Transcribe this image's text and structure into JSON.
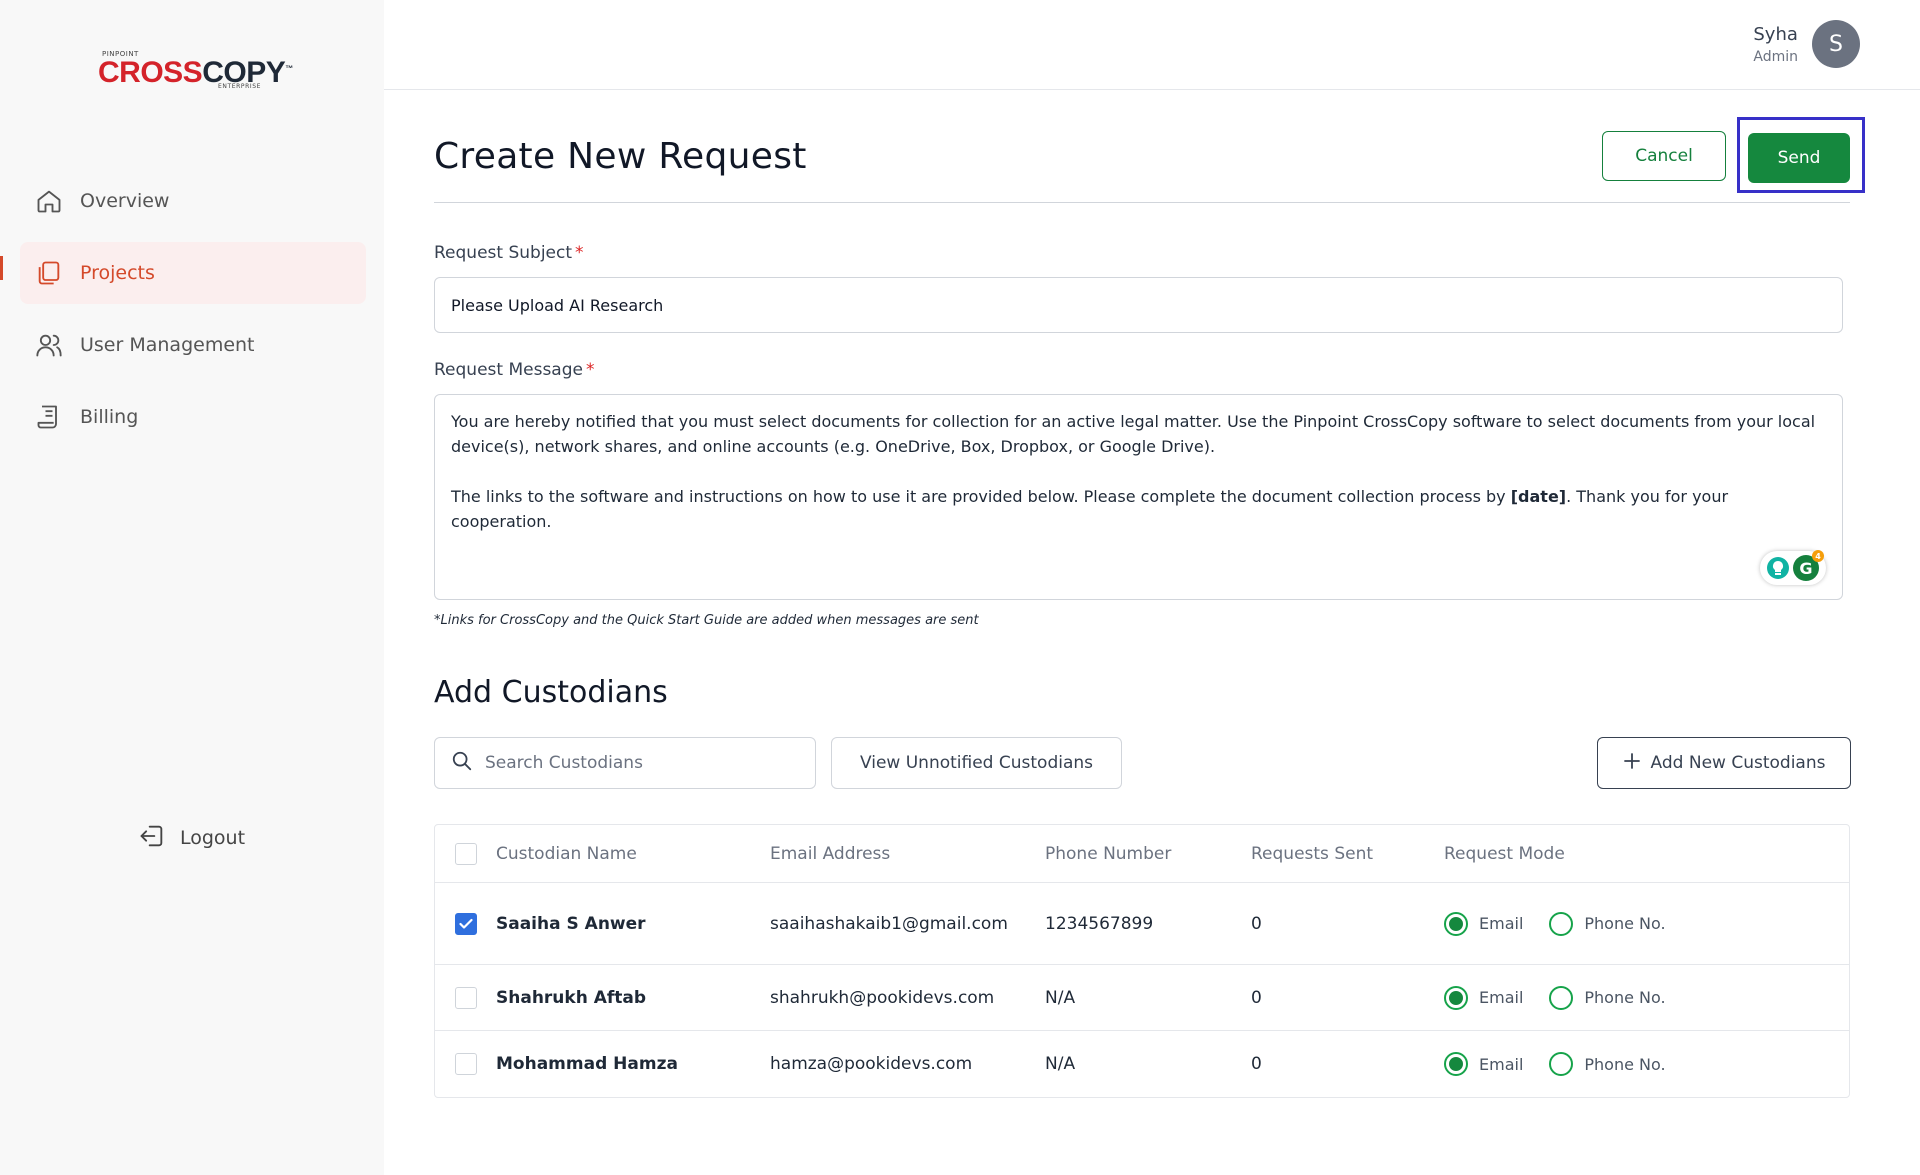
{
  "brand": {
    "pinpoint": "PINPOINT",
    "name_red": "CROSS",
    "name_dark": "COPY",
    "tm": "™",
    "enterprise": "ENTERPRISE"
  },
  "sidebar": {
    "items": [
      {
        "label": "Overview",
        "icon": "home-icon",
        "active": false
      },
      {
        "label": "Projects",
        "icon": "projects-icon",
        "active": true
      },
      {
        "label": "User Management",
        "icon": "users-icon",
        "active": false
      },
      {
        "label": "Billing",
        "icon": "billing-icon",
        "active": false
      }
    ],
    "logout_label": "Logout"
  },
  "user": {
    "name": "Syha",
    "role": "Admin",
    "initial": "S"
  },
  "page": {
    "title": "Create New Request",
    "cancel_label": "Cancel",
    "send_label": "Send"
  },
  "form": {
    "subject_label": "Request Subject",
    "required_mark": "*",
    "subject_value": "Please Upload AI Research",
    "message_label": "Request Message",
    "message_p1": "You are hereby notified that you must select documents for collection for an active legal matter. Use the Pinpoint CrossCopy software to select documents from your local device(s), network shares, and online accounts (e.g. OneDrive, Box, Dropbox, or Google Drive).",
    "message_p2_before": "The links to the software and instructions on how to use it are provided below. Please complete the document collection process by ",
    "message_p2_bold": "[date]",
    "message_p2_after": ". Thank you for your cooperation.",
    "grammarly_logo": "G",
    "grammarly_count": "4",
    "hint": "*Links for CrossCopy and the Quick Start Guide are added when messages are sent"
  },
  "custodians": {
    "section_title": "Add Custodians",
    "search_placeholder": "Search Custodians",
    "view_unnotified_label": "View Unnotified Custodians",
    "add_new_label": "Add New Custodians",
    "columns": [
      "Custodian Name",
      "Email Address",
      "Phone Number",
      "Requests Sent",
      "Request Mode"
    ],
    "mode_email_label": "Email",
    "mode_phone_label": "Phone No.",
    "rows": [
      {
        "name": "Saaiha S Anwer",
        "email": "saaihashakaib1@gmail.com",
        "phone": "1234567899",
        "sent": "0",
        "checked": true,
        "mode": "Email"
      },
      {
        "name": "Shahrukh Aftab",
        "email": "shahrukh@pookidevs.com",
        "phone": "N/A",
        "sent": "0",
        "checked": false,
        "mode": "Email"
      },
      {
        "name": "Mohammad Hamza",
        "email": "hamza@pookidevs.com",
        "phone": "N/A",
        "sent": "0",
        "checked": false,
        "mode": "Email"
      }
    ]
  },
  "colors": {
    "accent_green": "#15883e",
    "active_nav": "#d4492a",
    "brand_red": "#d4232a",
    "focus_outline": "#3730c8",
    "checkbox_blue": "#2f6fde"
  }
}
